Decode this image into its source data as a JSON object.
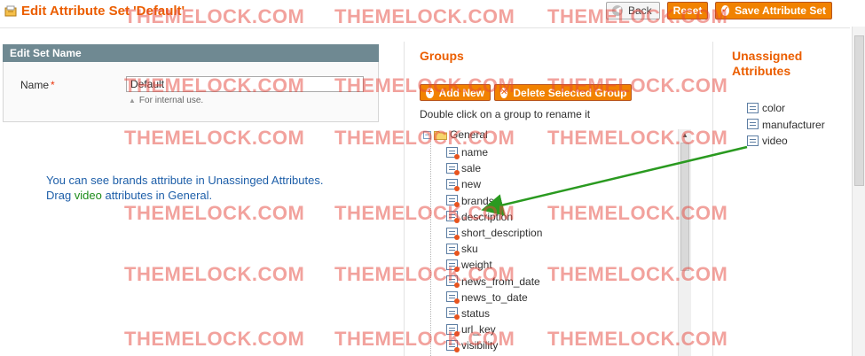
{
  "header": {
    "title": "Edit Attribute Set 'Default'",
    "back_label": "Back",
    "reset_label": "Reset",
    "save_label": "Save Attribute Set"
  },
  "edit_set_name": {
    "heading": "Edit Set Name",
    "name_label": "Name",
    "required_marker": "*",
    "name_value": "Default",
    "note": "For internal use."
  },
  "instructions": {
    "line1": "You can see brands attribute in Unassinged Attributes.",
    "line2_before": "Drag ",
    "line2_highlight": "video",
    "line2_after": " attributes in General."
  },
  "groups": {
    "title": "Groups",
    "add_new_label": "Add New",
    "delete_label": "Delete Selected Group",
    "hint": "Double click on a group to rename it",
    "root_label": "General",
    "items": [
      "name",
      "sale",
      "new",
      "brands",
      "description",
      "short_description",
      "sku",
      "weight",
      "news_from_date",
      "news_to_date",
      "status",
      "url_key",
      "visibility"
    ]
  },
  "unassigned": {
    "title": "Unassigned Attributes",
    "items": [
      "color",
      "manufacturer",
      "video"
    ]
  },
  "watermark": "THEMELOCK.COM",
  "colors": {
    "accent": "#eb5e00",
    "button": "#f18200",
    "panel_header": "#6f8992",
    "instruction_text": "#1e5fa9",
    "highlight": "#1d8c1a",
    "arrow": "#2a9a20"
  },
  "icons": {
    "page": "attribute-set-icon",
    "attribute": "attribute-icon",
    "folder": "folder-icon"
  }
}
